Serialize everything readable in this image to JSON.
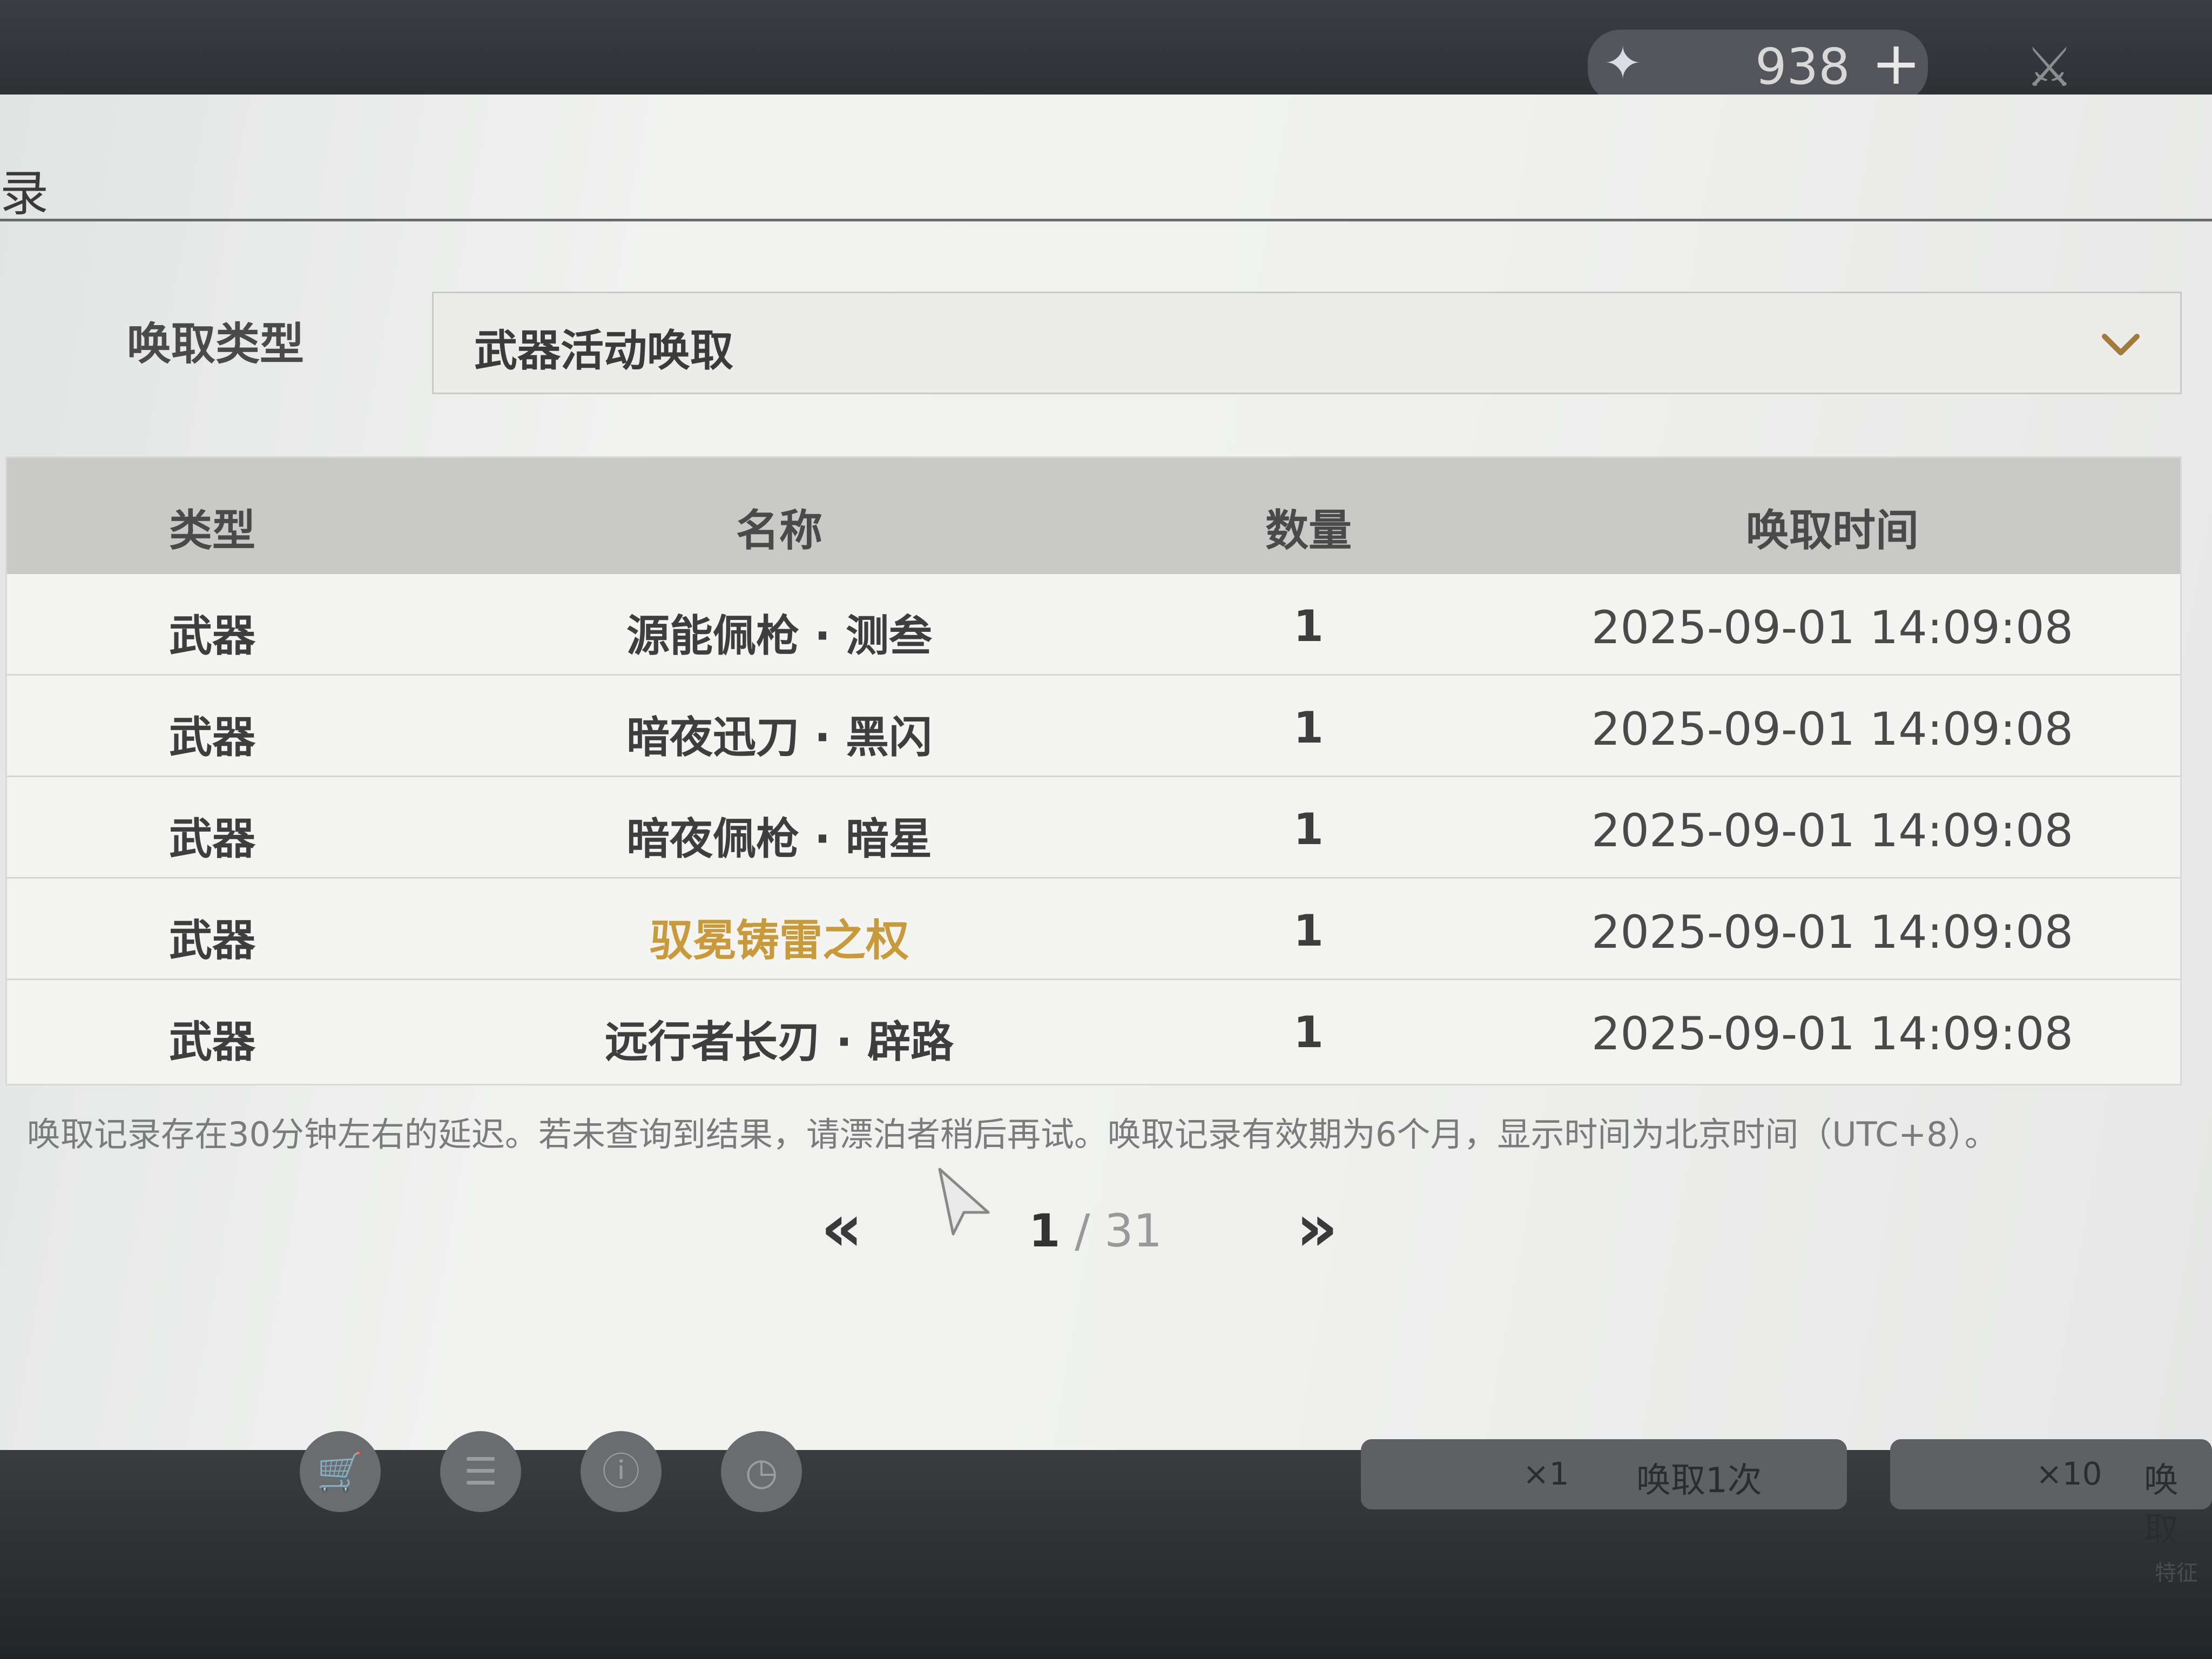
{
  "top_bar": {
    "currency_icon": "star-gem-icon",
    "currency_amount": "938",
    "currency_plus": "+",
    "right_icon": "sword-icon"
  },
  "dialog": {
    "title": "录",
    "filter": {
      "label": "唤取类型",
      "value": "武器活动唤取",
      "chevron_icon": "chevron-down-icon"
    },
    "table": {
      "headers": [
        "类型",
        "名称",
        "数量",
        "唤取时间"
      ],
      "rows": [
        {
          "type": "武器",
          "name": "源能佩枪 · 测叁",
          "qty": "1",
          "time": "2025-09-01 14:09:08",
          "highlight": false
        },
        {
          "type": "武器",
          "name": "暗夜迅刀 · 黑闪",
          "qty": "1",
          "time": "2025-09-01 14:09:08",
          "highlight": false
        },
        {
          "type": "武器",
          "name": "暗夜佩枪 · 暗星",
          "qty": "1",
          "time": "2025-09-01 14:09:08",
          "highlight": false
        },
        {
          "type": "武器",
          "name": "驭冕铸雷之权",
          "qty": "1",
          "time": "2025-09-01 14:09:08",
          "highlight": true
        },
        {
          "type": "武器",
          "name": "远行者长刃 · 辟路",
          "qty": "1",
          "time": "2025-09-01 14:09:08",
          "highlight": false
        }
      ]
    },
    "notice": "唤取记录存在30分钟左右的延迟。若未查询到结果，请漂泊者稍后再试。唤取记录有效期为6个月，显示时间为北京时间（UTC+8）。",
    "pagination": {
      "prev": "«",
      "current": "1",
      "separator": " / ",
      "total": "31",
      "next": "»"
    }
  },
  "bottom_bar": {
    "icons": [
      "cart-icon",
      "record-icon",
      "info-icon",
      "clock-icon"
    ],
    "wish_once": {
      "count": "×1",
      "label": "唤取1次"
    },
    "wish_ten": {
      "count": "×10",
      "label": "唤取"
    },
    "corner_text": "特征"
  },
  "colors": {
    "highlight_gold": "#c99a3a",
    "header_bg": "#c9cac8",
    "text_dark": "#3e3e3e"
  }
}
